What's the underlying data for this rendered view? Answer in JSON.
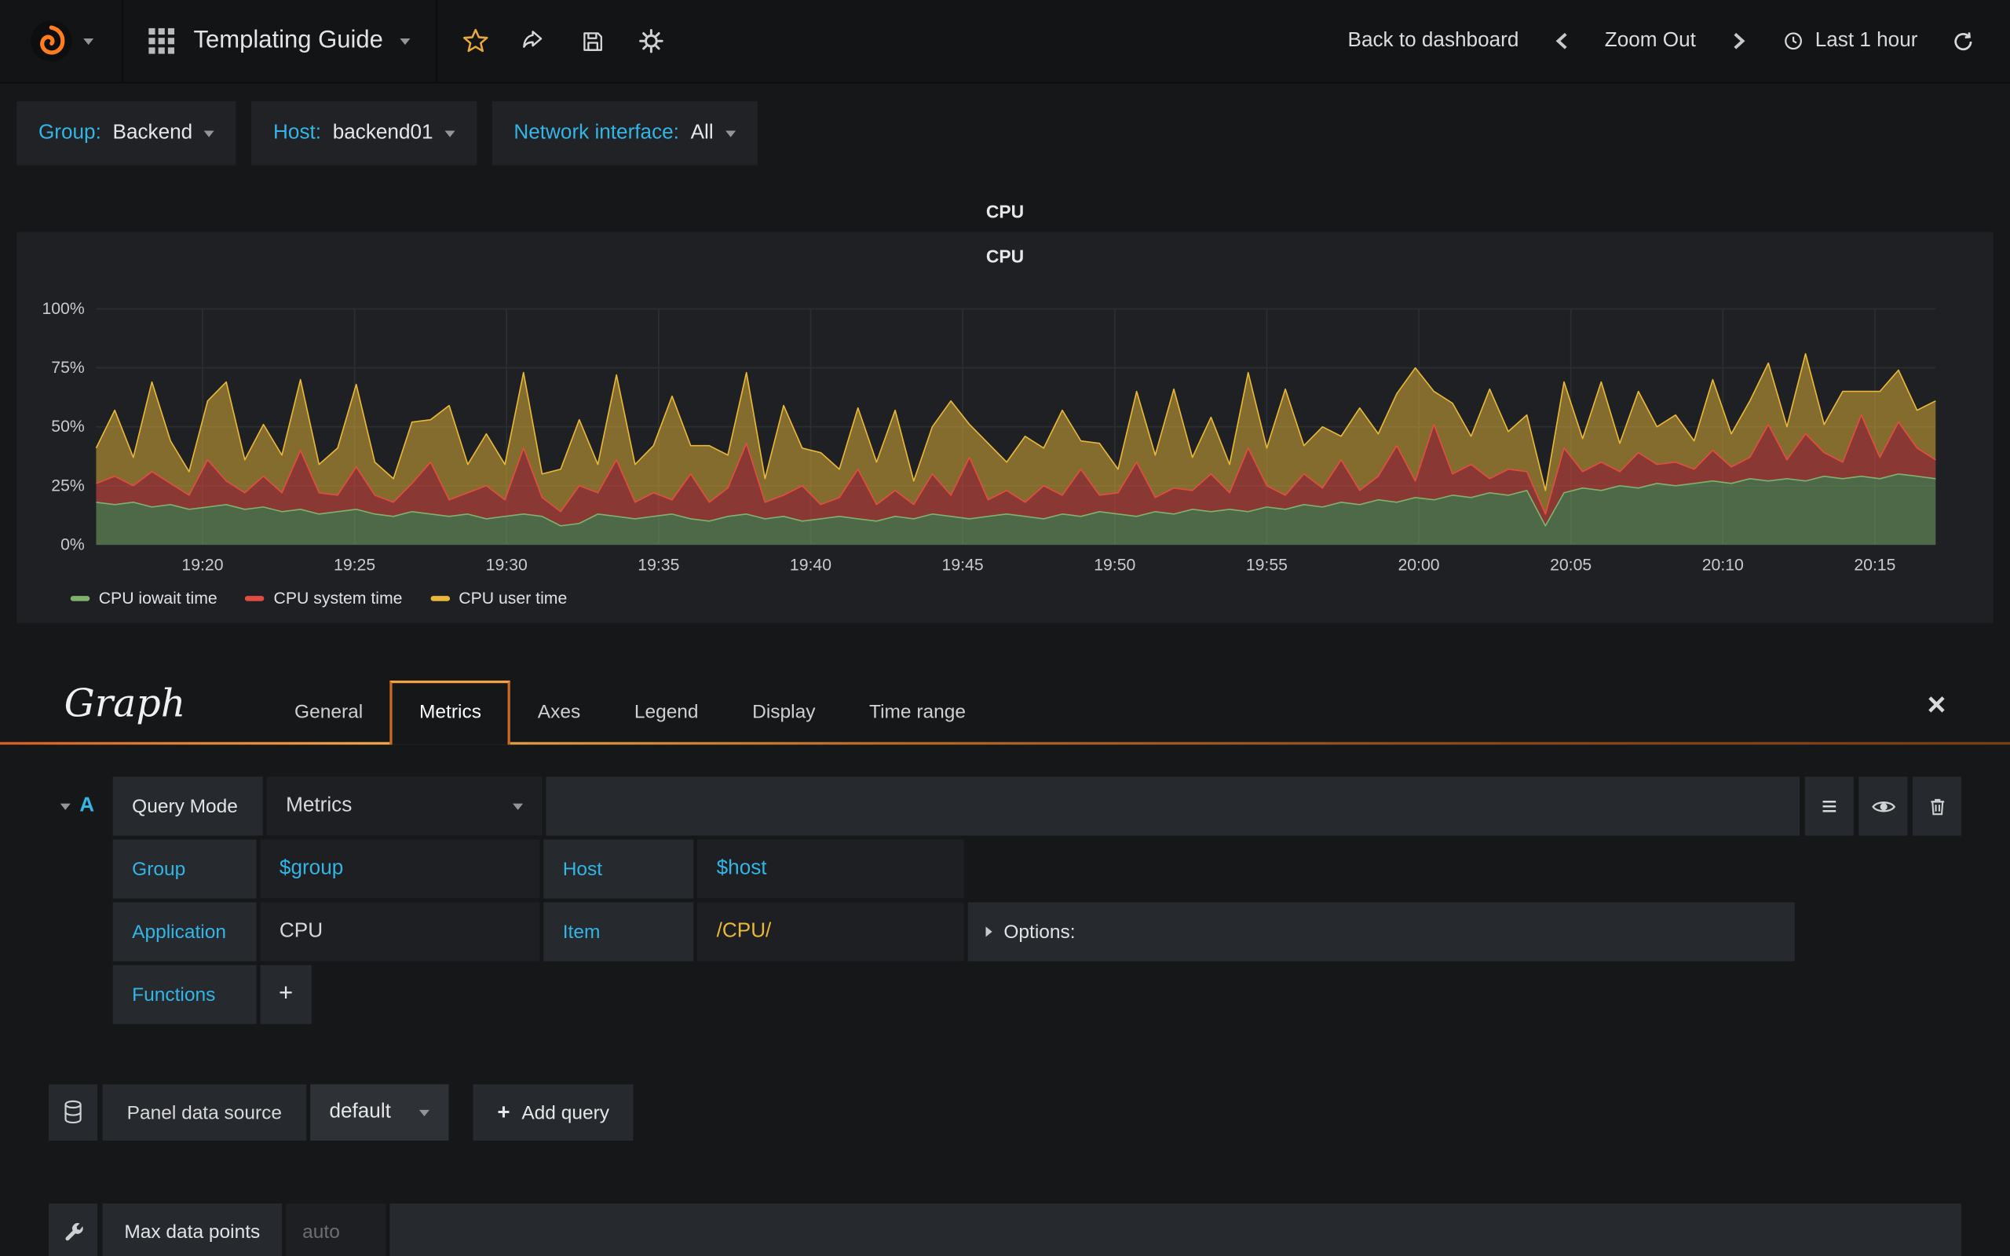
{
  "navbar": {
    "title": "Templating Guide",
    "back": "Back to dashboard",
    "zoom_out": "Zoom Out",
    "time_range": "Last 1 hour"
  },
  "template_vars": [
    {
      "label": "Group:",
      "value": "Backend"
    },
    {
      "label": "Host:",
      "value": "backend01"
    },
    {
      "label": "Network interface:",
      "value": "All"
    }
  ],
  "panel": {
    "title": "CPU",
    "chart_title": "CPU"
  },
  "chart_data": {
    "type": "area",
    "stacked": true,
    "title": "CPU",
    "y_max": 100,
    "y_ticks": [
      {
        "v": 0,
        "label": "0%"
      },
      {
        "v": 25,
        "label": "25%"
      },
      {
        "v": 50,
        "label": "50%"
      },
      {
        "v": 75,
        "label": "75%"
      },
      {
        "v": 100,
        "label": "100%"
      }
    ],
    "x_start_min": 1156.5,
    "x_end_min": 1217,
    "x_ticks": [
      "19:20",
      "19:25",
      "19:30",
      "19:35",
      "19:40",
      "19:45",
      "19:50",
      "19:55",
      "20:00",
      "20:05",
      "20:10",
      "20:15"
    ],
    "series": [
      {
        "name": "CPU iowait time",
        "color": "#7EB26D",
        "fill_opacity": 0.5,
        "values": [
          18,
          17,
          18,
          16,
          17,
          15,
          16,
          17,
          15,
          16,
          14,
          15,
          13,
          14,
          15,
          13,
          12,
          14,
          13,
          12,
          13,
          11,
          12,
          13,
          12,
          8,
          9,
          13,
          12,
          11,
          12,
          13,
          11,
          10,
          12,
          13,
          11,
          12,
          10,
          11,
          12,
          11,
          10,
          12,
          11,
          13,
          12,
          11,
          12,
          13,
          12,
          11,
          13,
          12,
          14,
          13,
          12,
          14,
          13,
          15,
          14,
          15,
          14,
          16,
          15,
          17,
          16,
          18,
          17,
          19,
          18,
          20,
          19,
          21,
          20,
          22,
          21,
          23,
          8,
          22,
          24,
          23,
          25,
          24,
          26,
          25,
          26,
          27,
          26,
          28,
          27,
          28,
          27,
          29,
          28,
          29,
          28,
          30,
          29,
          28
        ]
      },
      {
        "name": "CPU system time",
        "color": "#E24D42",
        "fill_opacity": 0.55,
        "values": [
          8,
          12,
          7,
          15,
          9,
          6,
          20,
          10,
          7,
          13,
          8,
          25,
          9,
          7,
          18,
          8,
          6,
          12,
          22,
          7,
          9,
          14,
          7,
          28,
          8,
          6,
          16,
          9,
          24,
          7,
          10,
          6,
          19,
          8,
          12,
          30,
          7,
          9,
          15,
          6,
          8,
          21,
          7,
          11,
          6,
          17,
          9,
          26,
          7,
          10,
          6,
          14,
          8,
          20,
          7,
          9,
          23,
          6,
          11,
          8,
          16,
          7,
          27,
          9,
          6,
          13,
          8,
          18,
          6,
          10,
          24,
          7,
          32,
          9,
          14,
          6,
          11,
          8,
          5,
          19,
          7,
          12,
          6,
          15,
          8,
          10,
          6,
          13,
          7,
          9,
          24,
          8,
          20,
          10,
          7,
          26,
          9,
          22,
          12,
          8
        ]
      },
      {
        "name": "CPU user time",
        "color": "#EAB839",
        "fill_opacity": 0.5,
        "values": [
          15,
          28,
          12,
          38,
          18,
          10,
          25,
          42,
          14,
          22,
          16,
          30,
          12,
          20,
          35,
          14,
          10,
          26,
          18,
          40,
          12,
          22,
          15,
          32,
          10,
          18,
          28,
          12,
          36,
          16,
          20,
          44,
          12,
          24,
          14,
          30,
          10,
          38,
          16,
          22,
          12,
          26,
          18,
          34,
          10,
          20,
          40,
          14,
          24,
          12,
          28,
          16,
          36,
          12,
          22,
          10,
          30,
          18,
          42,
          14,
          24,
          12,
          32,
          16,
          45,
          12,
          26,
          10,
          35,
          18,
          22,
          48,
          14,
          30,
          12,
          38,
          16,
          24,
          10,
          28,
          14,
          34,
          12,
          26,
          16,
          20,
          12,
          30,
          14,
          24,
          26,
          14,
          34,
          12,
          30,
          10,
          28,
          22,
          16,
          25
        ]
      }
    ]
  },
  "editor": {
    "title": "Graph",
    "tabs": [
      {
        "label": "General"
      },
      {
        "label": "Metrics"
      },
      {
        "label": "Axes"
      },
      {
        "label": "Legend"
      },
      {
        "label": "Display"
      },
      {
        "label": "Time range"
      }
    ],
    "active_tab": "Metrics",
    "query": {
      "ref": "A",
      "mode_label": "Query Mode",
      "mode_value": "Metrics",
      "group_label": "Group",
      "group_value": "$group",
      "host_label": "Host",
      "host_value": "$host",
      "app_label": "Application",
      "app_value": "CPU",
      "item_label": "Item",
      "item_value": "/CPU/",
      "options_label": "Options:",
      "functions_label": "Functions"
    },
    "datasource": {
      "label": "Panel data source",
      "value": "default",
      "add_query": "Add query"
    },
    "bottom": {
      "label": "Max data points",
      "placeholder": "auto"
    }
  },
  "icons": {
    "plus": "+",
    "menu": "≡",
    "close": "×"
  },
  "colors": {
    "accent": "#33B5E5",
    "highlight_orange": "#F3A33F",
    "page_bg": "#161719",
    "panel_bg": "#1F2023"
  }
}
